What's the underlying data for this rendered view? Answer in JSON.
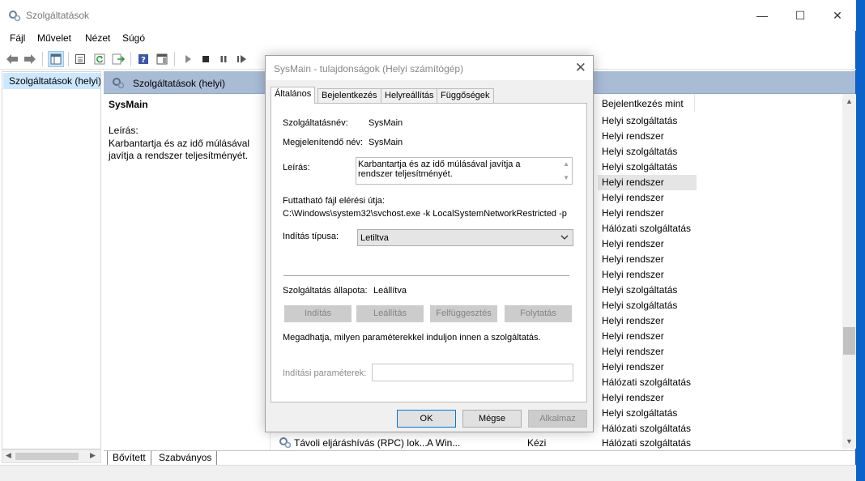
{
  "window": {
    "title": "Szolgáltatások",
    "minimize": "—",
    "maximize": "☐",
    "close": "✕"
  },
  "menu": [
    "Fájl",
    "Művelet",
    "Nézet",
    "Súgó"
  ],
  "tree": {
    "item": "Szolgáltatások (helyi)"
  },
  "pane_header": "Szolgáltatások (helyi)",
  "description_pane": {
    "name": "SysMain",
    "label": "Leírás:",
    "text": "Karbantartja és az idő múlásával javítja a rendszer teljesítményét."
  },
  "column": {
    "header": "Bejelentkezés mint",
    "rows": [
      "Helyi szolgáltatás",
      "Helyi rendszer",
      "Helyi szolgáltatás",
      "Helyi szolgáltatás",
      "Helyi rendszer",
      "Helyi rendszer",
      "Helyi rendszer",
      "Hálózati szolgáltatás",
      "Helyi rendszer",
      "Helyi rendszer",
      "Helyi rendszer",
      "Helyi szolgáltatás",
      "Helyi szolgáltatás",
      "Helyi rendszer",
      "Helyi rendszer",
      "Helyi rendszer",
      "Helyi rendszer",
      "Hálózati szolgáltatás",
      "Helyi rendszer",
      "Helyi szolgáltatás",
      "Hálózati szolgáltatás"
    ]
  },
  "bottom_row": {
    "name": "Távoli eljáráshívás (RPC) lok...",
    "desc": "A Win...",
    "startup": "Kézi",
    "logon": "Hálózati szolgáltatás"
  },
  "bottom_tabs": [
    "Bővített",
    "Szabványos"
  ],
  "dialog": {
    "title": "SysMain - tulajdonságok (Helyi számítógép)",
    "tabs": [
      "Általános",
      "Bejelentkezés",
      "Helyreállítás",
      "Függőségek"
    ],
    "service_name_label": "Szolgáltatásnév:",
    "service_name": "SysMain",
    "display_name_label": "Megjelenítendő név:",
    "display_name": "SysMain",
    "description_label": "Leírás:",
    "description": "Karbantartja és az idő múlásával javítja a rendszer teljesítményét.",
    "exe_label": "Futtatható fájl elérési útja:",
    "exe_path": "C:\\Windows\\system32\\svchost.exe -k LocalSystemNetworkRestricted -p",
    "startup_label": "Indítás típusa:",
    "startup_value": "Letiltva",
    "status_label": "Szolgáltatás állapota:",
    "status_value": "Leállítva",
    "buttons": {
      "start": "Indítás",
      "stop": "Leállítás",
      "pause": "Felfüggesztés",
      "resume": "Folytatás"
    },
    "hint": "Megadhatja, milyen paraméterekkel induljon innen a szolgáltatás.",
    "params_label": "Indítási paraméterek:",
    "params_value": "",
    "ok": "OK",
    "cancel": "Mégse",
    "apply": "Alkalmaz"
  },
  "colors": {
    "accent": "#0078d7",
    "header_bg": "#a8bcd6",
    "selection": "#cce8ff"
  }
}
